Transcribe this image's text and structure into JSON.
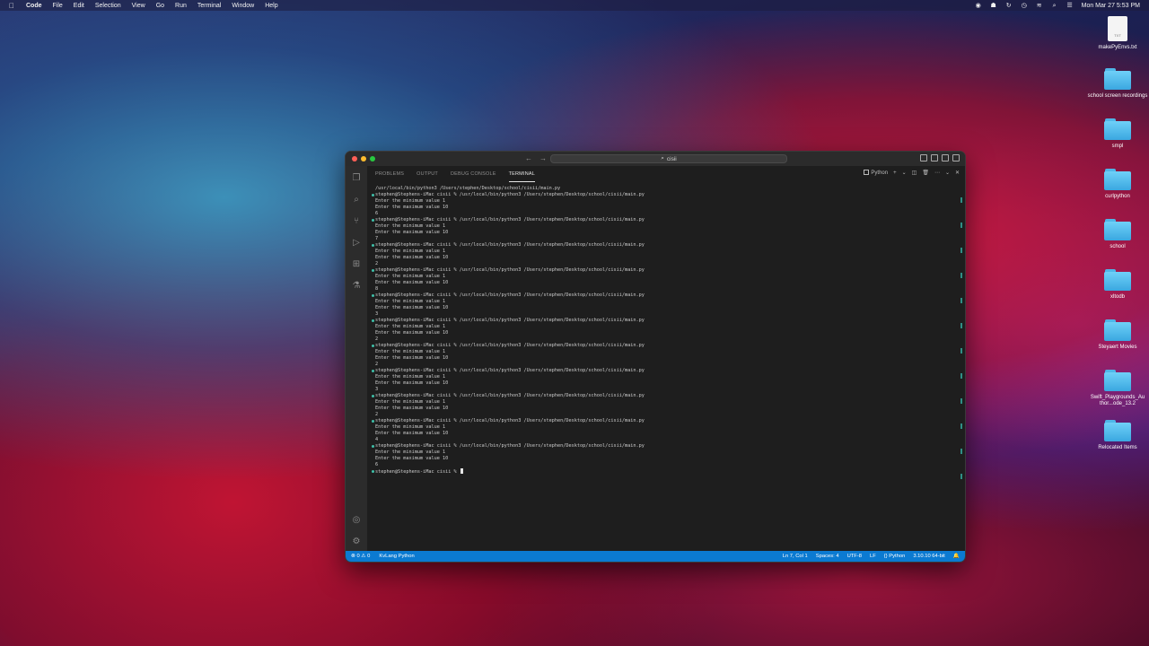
{
  "menubar": {
    "app": "Code",
    "items": [
      "File",
      "Edit",
      "Selection",
      "View",
      "Go",
      "Run",
      "Terminal",
      "Window",
      "Help"
    ],
    "clock": "Mon Mar 27  5:53 PM"
  },
  "desktop": {
    "items": [
      {
        "label": "makePyEnvs.txt",
        "type": "file",
        "badge": "TXT"
      },
      {
        "label": "school screen recordings",
        "type": "folder"
      },
      {
        "label": "smpl",
        "type": "folder"
      },
      {
        "label": "curlpython",
        "type": "folder"
      },
      {
        "label": "school",
        "type": "folder"
      },
      {
        "label": "xltodb",
        "type": "folder"
      },
      {
        "label": "Steyaert Movies",
        "type": "folder"
      },
      {
        "label": "Swift_Playgrounds_Author...ode_13.2",
        "type": "folder"
      },
      {
        "label": "Relocated Items",
        "type": "folder"
      }
    ]
  },
  "window": {
    "search": "cisii",
    "tabs": [
      "PROBLEMS",
      "OUTPUT",
      "DEBUG CONSOLE",
      "TERMINAL"
    ],
    "active_tab": "TERMINAL",
    "terminal_profile": "Python",
    "terminal_lines": [
      {
        "text": "/usr/local/bin/python3 /Users/stephen/Desktop/school/cisii/main.py",
        "cmd": false
      },
      {
        "text": "stephen@Stephens-iMac cisii % /usr/local/bin/python3 /Users/stephen/Desktop/school/cisii/main.py",
        "cmd": true
      },
      {
        "text": "Enter the minimum value 1",
        "cmd": false
      },
      {
        "text": "Enter the maximum value 10",
        "cmd": false
      },
      {
        "text": "6",
        "cmd": false
      },
      {
        "text": "stephen@Stephens-iMac cisii % /usr/local/bin/python3 /Users/stephen/Desktop/school/cisii/main.py",
        "cmd": true
      },
      {
        "text": "Enter the minimum value 1",
        "cmd": false
      },
      {
        "text": "Enter the maximum value 10",
        "cmd": false
      },
      {
        "text": "7",
        "cmd": false
      },
      {
        "text": "stephen@Stephens-iMac cisii % /usr/local/bin/python3 /Users/stephen/Desktop/school/cisii/main.py",
        "cmd": true
      },
      {
        "text": "Enter the minimum value 1",
        "cmd": false
      },
      {
        "text": "Enter the maximum value 10",
        "cmd": false
      },
      {
        "text": "2",
        "cmd": false
      },
      {
        "text": "stephen@Stephens-iMac cisii % /usr/local/bin/python3 /Users/stephen/Desktop/school/cisii/main.py",
        "cmd": true
      },
      {
        "text": "Enter the minimum value 1",
        "cmd": false
      },
      {
        "text": "Enter the maximum value 10",
        "cmd": false
      },
      {
        "text": "8",
        "cmd": false
      },
      {
        "text": "stephen@Stephens-iMac cisii % /usr/local/bin/python3 /Users/stephen/Desktop/school/cisii/main.py",
        "cmd": true
      },
      {
        "text": "Enter the minimum value 1",
        "cmd": false
      },
      {
        "text": "Enter the maximum value 10",
        "cmd": false
      },
      {
        "text": "3",
        "cmd": false
      },
      {
        "text": "stephen@Stephens-iMac cisii % /usr/local/bin/python3 /Users/stephen/Desktop/school/cisii/main.py",
        "cmd": true
      },
      {
        "text": "Enter the minimum value 1",
        "cmd": false
      },
      {
        "text": "Enter the maximum value 10",
        "cmd": false
      },
      {
        "text": "2",
        "cmd": false
      },
      {
        "text": "stephen@Stephens-iMac cisii % /usr/local/bin/python3 /Users/stephen/Desktop/school/cisii/main.py",
        "cmd": true
      },
      {
        "text": "Enter the minimum value 1",
        "cmd": false
      },
      {
        "text": "Enter the maximum value 10",
        "cmd": false
      },
      {
        "text": "2",
        "cmd": false
      },
      {
        "text": "stephen@Stephens-iMac cisii % /usr/local/bin/python3 /Users/stephen/Desktop/school/cisii/main.py",
        "cmd": true
      },
      {
        "text": "Enter the minimum value 1",
        "cmd": false
      },
      {
        "text": "Enter the maximum value 10",
        "cmd": false
      },
      {
        "text": "3",
        "cmd": false
      },
      {
        "text": "stephen@Stephens-iMac cisii % /usr/local/bin/python3 /Users/stephen/Desktop/school/cisii/main.py",
        "cmd": true
      },
      {
        "text": "Enter the minimum value 1",
        "cmd": false
      },
      {
        "text": "Enter the maximum value 10",
        "cmd": false
      },
      {
        "text": "2",
        "cmd": false
      },
      {
        "text": "stephen@Stephens-iMac cisii % /usr/local/bin/python3 /Users/stephen/Desktop/school/cisii/main.py",
        "cmd": true
      },
      {
        "text": "Enter the minimum value 1",
        "cmd": false
      },
      {
        "text": "Enter the maximum value 10",
        "cmd": false
      },
      {
        "text": "4",
        "cmd": false
      },
      {
        "text": "stephen@Stephens-iMac cisii % /usr/local/bin/python3 /Users/stephen/Desktop/school/cisii/main.py",
        "cmd": true
      },
      {
        "text": "Enter the minimum value 1",
        "cmd": false
      },
      {
        "text": "Enter the maximum value 10",
        "cmd": false
      },
      {
        "text": "6",
        "cmd": false
      },
      {
        "text": "stephen@Stephens-iMac cisii % ",
        "cmd": true,
        "cursor": true
      }
    ]
  },
  "statusbar": {
    "problems": "⊗ 0 ⚠ 0",
    "left_item": "KvLang Python",
    "position": "Ln 7, Col 1",
    "spaces": "Spaces: 4",
    "encoding": "UTF-8",
    "eol": "LF",
    "language": "Python",
    "interpreter": "3.10.10 64-bit"
  },
  "colors": {
    "statusbar": "#0b7ad1",
    "accent_teal": "#3fbfa8",
    "close": "#ff5f57",
    "minimize": "#febc2e",
    "zoom": "#28c840"
  }
}
